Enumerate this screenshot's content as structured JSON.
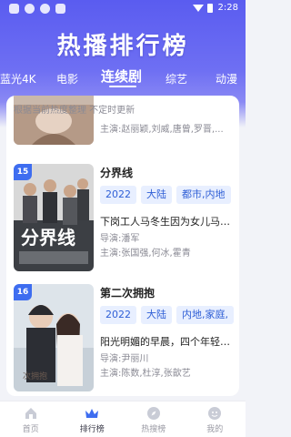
{
  "status_bar": {
    "time": "2:28"
  },
  "page_title": "热播排行榜",
  "tabs": [
    {
      "label": "蓝光4K"
    },
    {
      "label": "电影"
    },
    {
      "label": "连续剧"
    },
    {
      "label": "综艺"
    },
    {
      "label": "动漫"
    }
  ],
  "active_tab": "连续剧",
  "panel_note": "根据当前热度整理 不定时更新",
  "items": [
    {
      "cast": "主演:赵丽颖,刘威,唐曾,罗晋,..."
    },
    {
      "rank": "15",
      "title": "分界线",
      "tags": [
        "2022",
        "大陆",
        "都市,内地"
      ],
      "description": "下岗工人马冬生因为女儿马瑾...",
      "director": "导演:潘军",
      "cast": "主演:张国强,何冰,霍青"
    },
    {
      "rank": "16",
      "title": "第二次拥抱",
      "tags": [
        "2022",
        "大陆",
        "内地,家庭,"
      ],
      "description": "阳光明媚的早晨，四个年轻妈...",
      "director": "导演:尹丽川",
      "cast": "主演:陈数,杜淳,张歆艺"
    }
  ],
  "bottom_nav": [
    {
      "label": "首页",
      "icon": "home-icon"
    },
    {
      "label": "排行榜",
      "icon": "crown-icon"
    },
    {
      "label": "热搜榜",
      "icon": "compass-icon"
    },
    {
      "label": "我的",
      "icon": "profile-icon"
    }
  ],
  "colors": {
    "header": "#5a5cf0",
    "accent": "#3e6df0",
    "tag_bg": "#e8efff",
    "tag_text": "#2f5fd6"
  }
}
